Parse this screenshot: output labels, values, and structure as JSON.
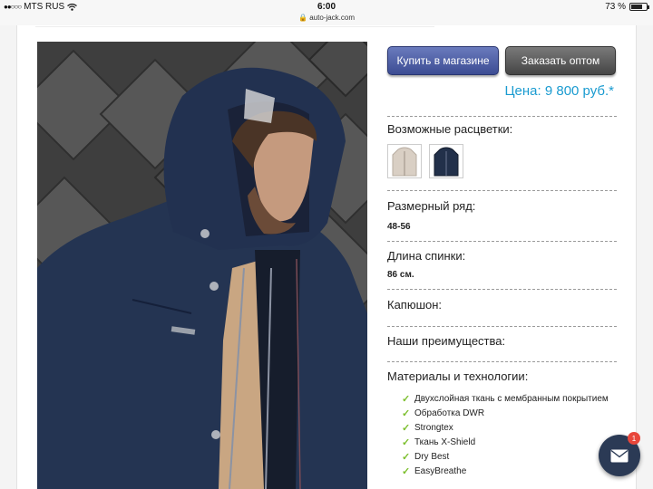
{
  "status_bar": {
    "carrier": "MTS RUS",
    "time": "6:00",
    "url": "auto-jack.com",
    "battery_percent": "73 %",
    "battery_level": 0.73
  },
  "buttons": {
    "buy_in_store": "Купить в магазине",
    "order_wholesale": "Заказать оптом"
  },
  "price": "Цена: 9 800 руб.*",
  "colors_label": "Возможные расцветки:",
  "swatches": [
    {
      "name": "beige",
      "color": "#d9cfc4"
    },
    {
      "name": "navy",
      "color": "#22304a"
    }
  ],
  "size_label": "Размерный ряд:",
  "size_value": "48-56",
  "length_label": "Длина спинки:",
  "length_value": "86 см.",
  "hood_label": "Капюшон:",
  "advantages_label": "Наши преимущества:",
  "materials_label": "Материалы и технологии:",
  "features": [
    "Двухслойная ткань с мембранным покрытием",
    "Обработка DWR",
    "Strongtex",
    "Ткань X-Shield",
    "Dry Best",
    "EasyBreathe"
  ],
  "chat": {
    "badge": "1"
  },
  "accent_colors": {
    "price": "#1a9bd0",
    "check": "#7cbf2d",
    "buy_button": "#4a5aa3",
    "order_button": "#555555"
  }
}
